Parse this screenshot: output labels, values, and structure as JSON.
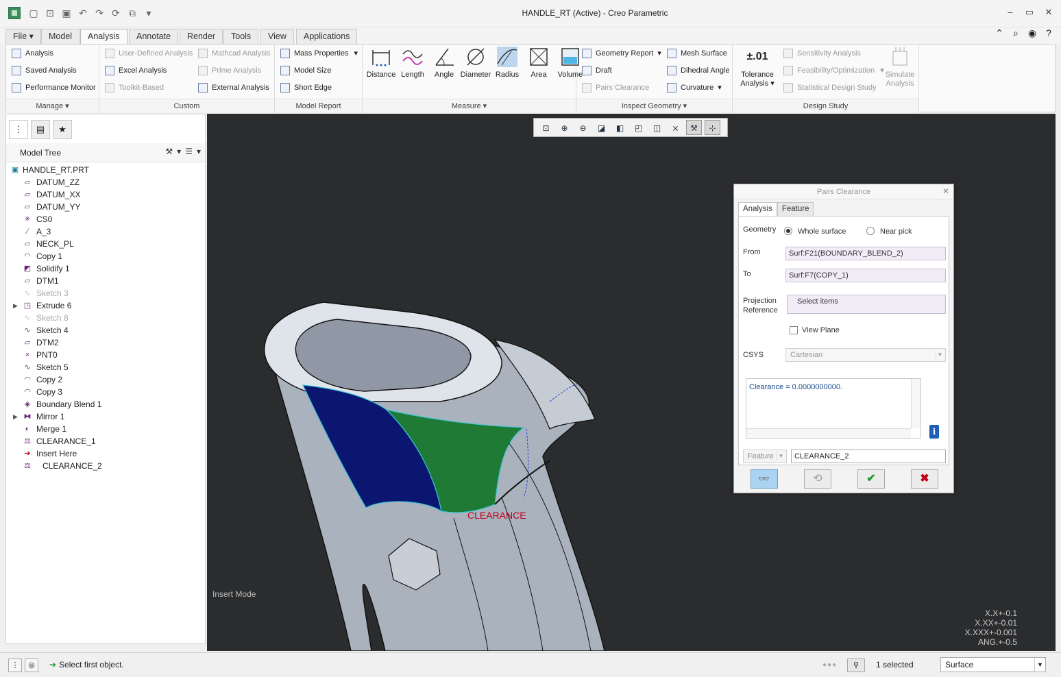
{
  "window": {
    "title": "HANDLE_RT (Active) - Creo Parametric"
  },
  "menu_tabs": [
    {
      "label": "File ▾"
    },
    {
      "label": "Model"
    },
    {
      "label": "Analysis"
    },
    {
      "label": "Annotate"
    },
    {
      "label": "Render"
    },
    {
      "label": "Tools"
    },
    {
      "label": "View"
    },
    {
      "label": "Applications"
    }
  ],
  "ribbon": {
    "manage": {
      "label": "Manage ▾",
      "items": [
        "Analysis",
        "Saved Analysis",
        "Performance Monitor"
      ]
    },
    "custom": {
      "label": "Custom",
      "items": [
        "User-Defined Analysis",
        "Mathcad Analysis",
        "Excel Analysis",
        "Prime Analysis",
        "Toolkit-Based",
        "External Analysis"
      ]
    },
    "model_report": {
      "label": "Model Report",
      "items": [
        "Mass Properties",
        "Model Size",
        "Short Edge"
      ]
    },
    "measure": {
      "label": "Measure ▾",
      "items": [
        "Distance",
        "Length",
        "Angle",
        "Diameter",
        "Radius",
        "Area",
        "Volume"
      ]
    },
    "inspect_geometry": {
      "label": "Inspect Geometry ▾",
      "items": [
        "Geometry Report",
        "Mesh Surface",
        "Draft",
        "Dihedral Angle",
        "Pairs Clearance",
        "Curvature"
      ]
    },
    "design_study": {
      "label": "Design Study",
      "tolerance_icon": "±.01",
      "tolerance_label_1": "Tolerance",
      "tolerance_label_2": "Analysis ▾",
      "items": [
        "Sensitivity Analysis",
        "Feasibility/Optimization",
        "Statistical Design Study"
      ],
      "simulate_1": "Simulate",
      "simulate_2": "Analysis"
    }
  },
  "model_tree": {
    "title": "Model Tree",
    "nodes": [
      {
        "label": "HANDLE_RT.PRT",
        "icon": "part-icon"
      },
      {
        "label": "DATUM_ZZ",
        "icon": "datum-plane-icon"
      },
      {
        "label": "DATUM_XX",
        "icon": "datum-plane-icon"
      },
      {
        "label": "DATUM_YY",
        "icon": "datum-plane-icon"
      },
      {
        "label": "CS0",
        "icon": "csys-icon"
      },
      {
        "label": "A_3",
        "icon": "axis-icon"
      },
      {
        "label": "NECK_PL",
        "icon": "datum-plane-icon"
      },
      {
        "label": "Copy 1",
        "icon": "copy-icon"
      },
      {
        "label": "Solidify 1",
        "icon": "solidify-icon"
      },
      {
        "label": "DTM1",
        "icon": "datum-plane-icon"
      },
      {
        "label": "Sketch 3",
        "icon": "sketch-icon"
      },
      {
        "label": "Extrude 6",
        "icon": "extrude-icon"
      },
      {
        "label": "Sketch 8",
        "icon": "sketch-icon"
      },
      {
        "label": "Sketch 4",
        "icon": "sketch-icon"
      },
      {
        "label": "DTM2",
        "icon": "datum-plane-icon"
      },
      {
        "label": "PNT0",
        "icon": "point-icon"
      },
      {
        "label": "Sketch 5",
        "icon": "sketch-icon"
      },
      {
        "label": "Copy 2",
        "icon": "copy-icon"
      },
      {
        "label": "Copy 3",
        "icon": "copy-icon"
      },
      {
        "label": "Boundary Blend 1",
        "icon": "boundary-blend-icon"
      },
      {
        "label": "Mirror 1",
        "icon": "mirror-icon"
      },
      {
        "label": "Merge 1",
        "icon": "merge-icon"
      },
      {
        "label": "CLEARANCE_1",
        "icon": "analysis-icon"
      },
      {
        "label": "Insert Here",
        "icon": "insert-arrow-icon"
      },
      {
        "label": "CLEARANCE_2",
        "icon": "analysis-icon"
      }
    ]
  },
  "graphics": {
    "mode_text": "Insert Mode",
    "model_label": "CLEARANCE",
    "tolerances": [
      "X.X+-0.1",
      "X.XX+-0.01",
      "X.XXX+-0.001",
      "ANG.+-0.5"
    ]
  },
  "dialog": {
    "title": "Pairs Clearance",
    "tabs": [
      "Analysis",
      "Feature"
    ],
    "geometry_label": "Geometry",
    "geometry_options": [
      "Whole surface",
      "Near pick"
    ],
    "from_label": "From",
    "from_value": "Surf:F21(BOUNDARY_BLEND_2)",
    "to_label": "To",
    "to_value": "Surf:F7(COPY_1)",
    "projection_label_1": "Projection",
    "projection_label_2": "Reference",
    "projection_value": "Select items",
    "view_plane_label": "View Plane",
    "csys_label": "CSYS",
    "csys_value": "Cartesian",
    "result": "Clearance = 0.0000000000.",
    "feature_type": "Feature",
    "feature_name": "CLEARANCE_2"
  },
  "status": {
    "message": "Select first object.",
    "selected": "1 selected",
    "filter": "Surface"
  }
}
